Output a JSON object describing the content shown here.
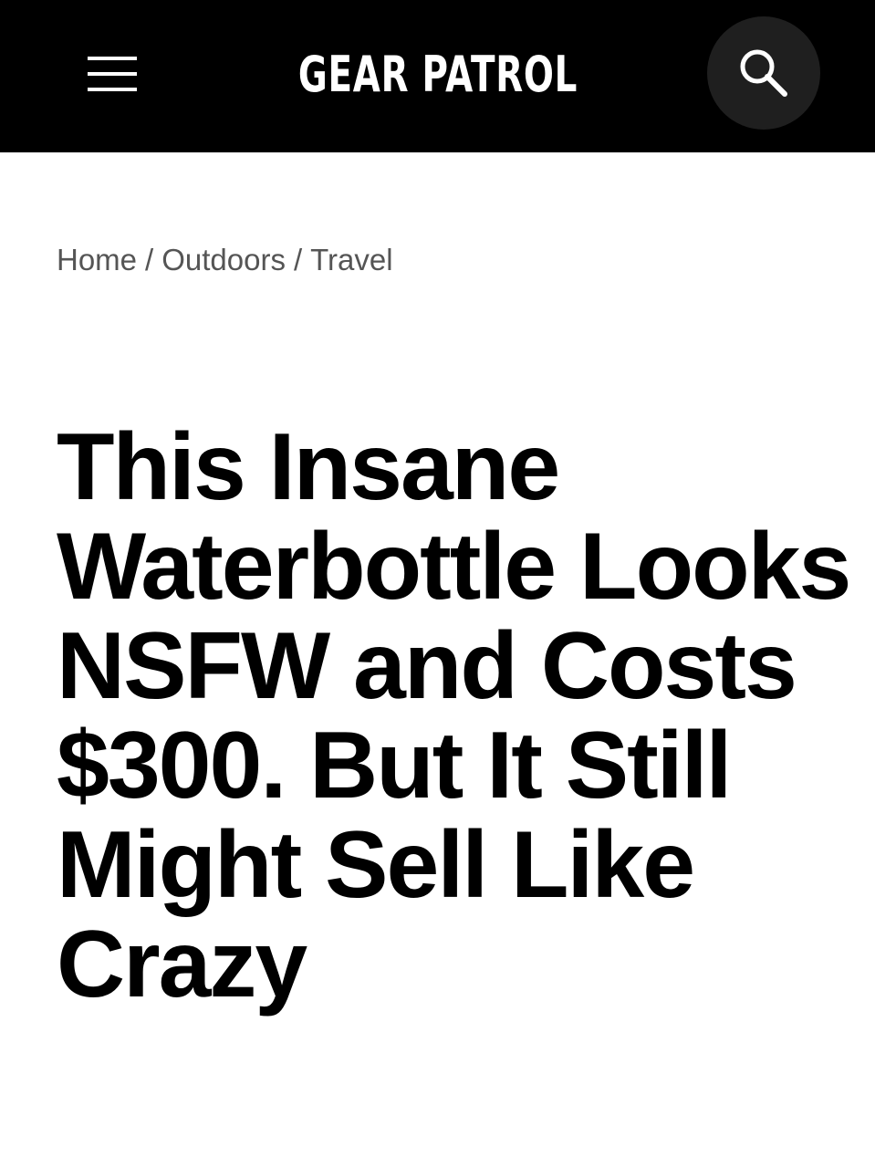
{
  "header": {
    "logo_text": "GEAR PATROL",
    "menu_icon": "hamburger-menu-icon",
    "search_icon": "search-icon",
    "background_color": "#000000",
    "search_button_color": "#1f1f1f"
  },
  "breadcrumb": {
    "items": [
      "Home",
      "Outdoors",
      "Travel"
    ],
    "separator": "/"
  },
  "article": {
    "title": "This Insane Waterbottle Looks NSFW and Costs $300. But It Still Might Sell Like Crazy"
  }
}
